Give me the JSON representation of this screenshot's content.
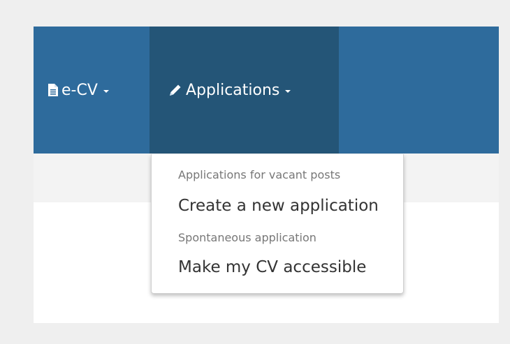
{
  "navbar": {
    "items": [
      {
        "label": "e-CV",
        "icon": "document-icon"
      },
      {
        "label": "Applications",
        "icon": "pencil-icon"
      }
    ]
  },
  "dropdown": {
    "sections": [
      {
        "header": "Applications for vacant posts",
        "items": [
          "Create a new application"
        ]
      },
      {
        "header": "Spontaneous application",
        "items": [
          "Make my CV accessible"
        ]
      }
    ]
  },
  "colors": {
    "navbar": "#2e6b9c",
    "navbar_active": "#245577",
    "page_background": "#efefef"
  }
}
